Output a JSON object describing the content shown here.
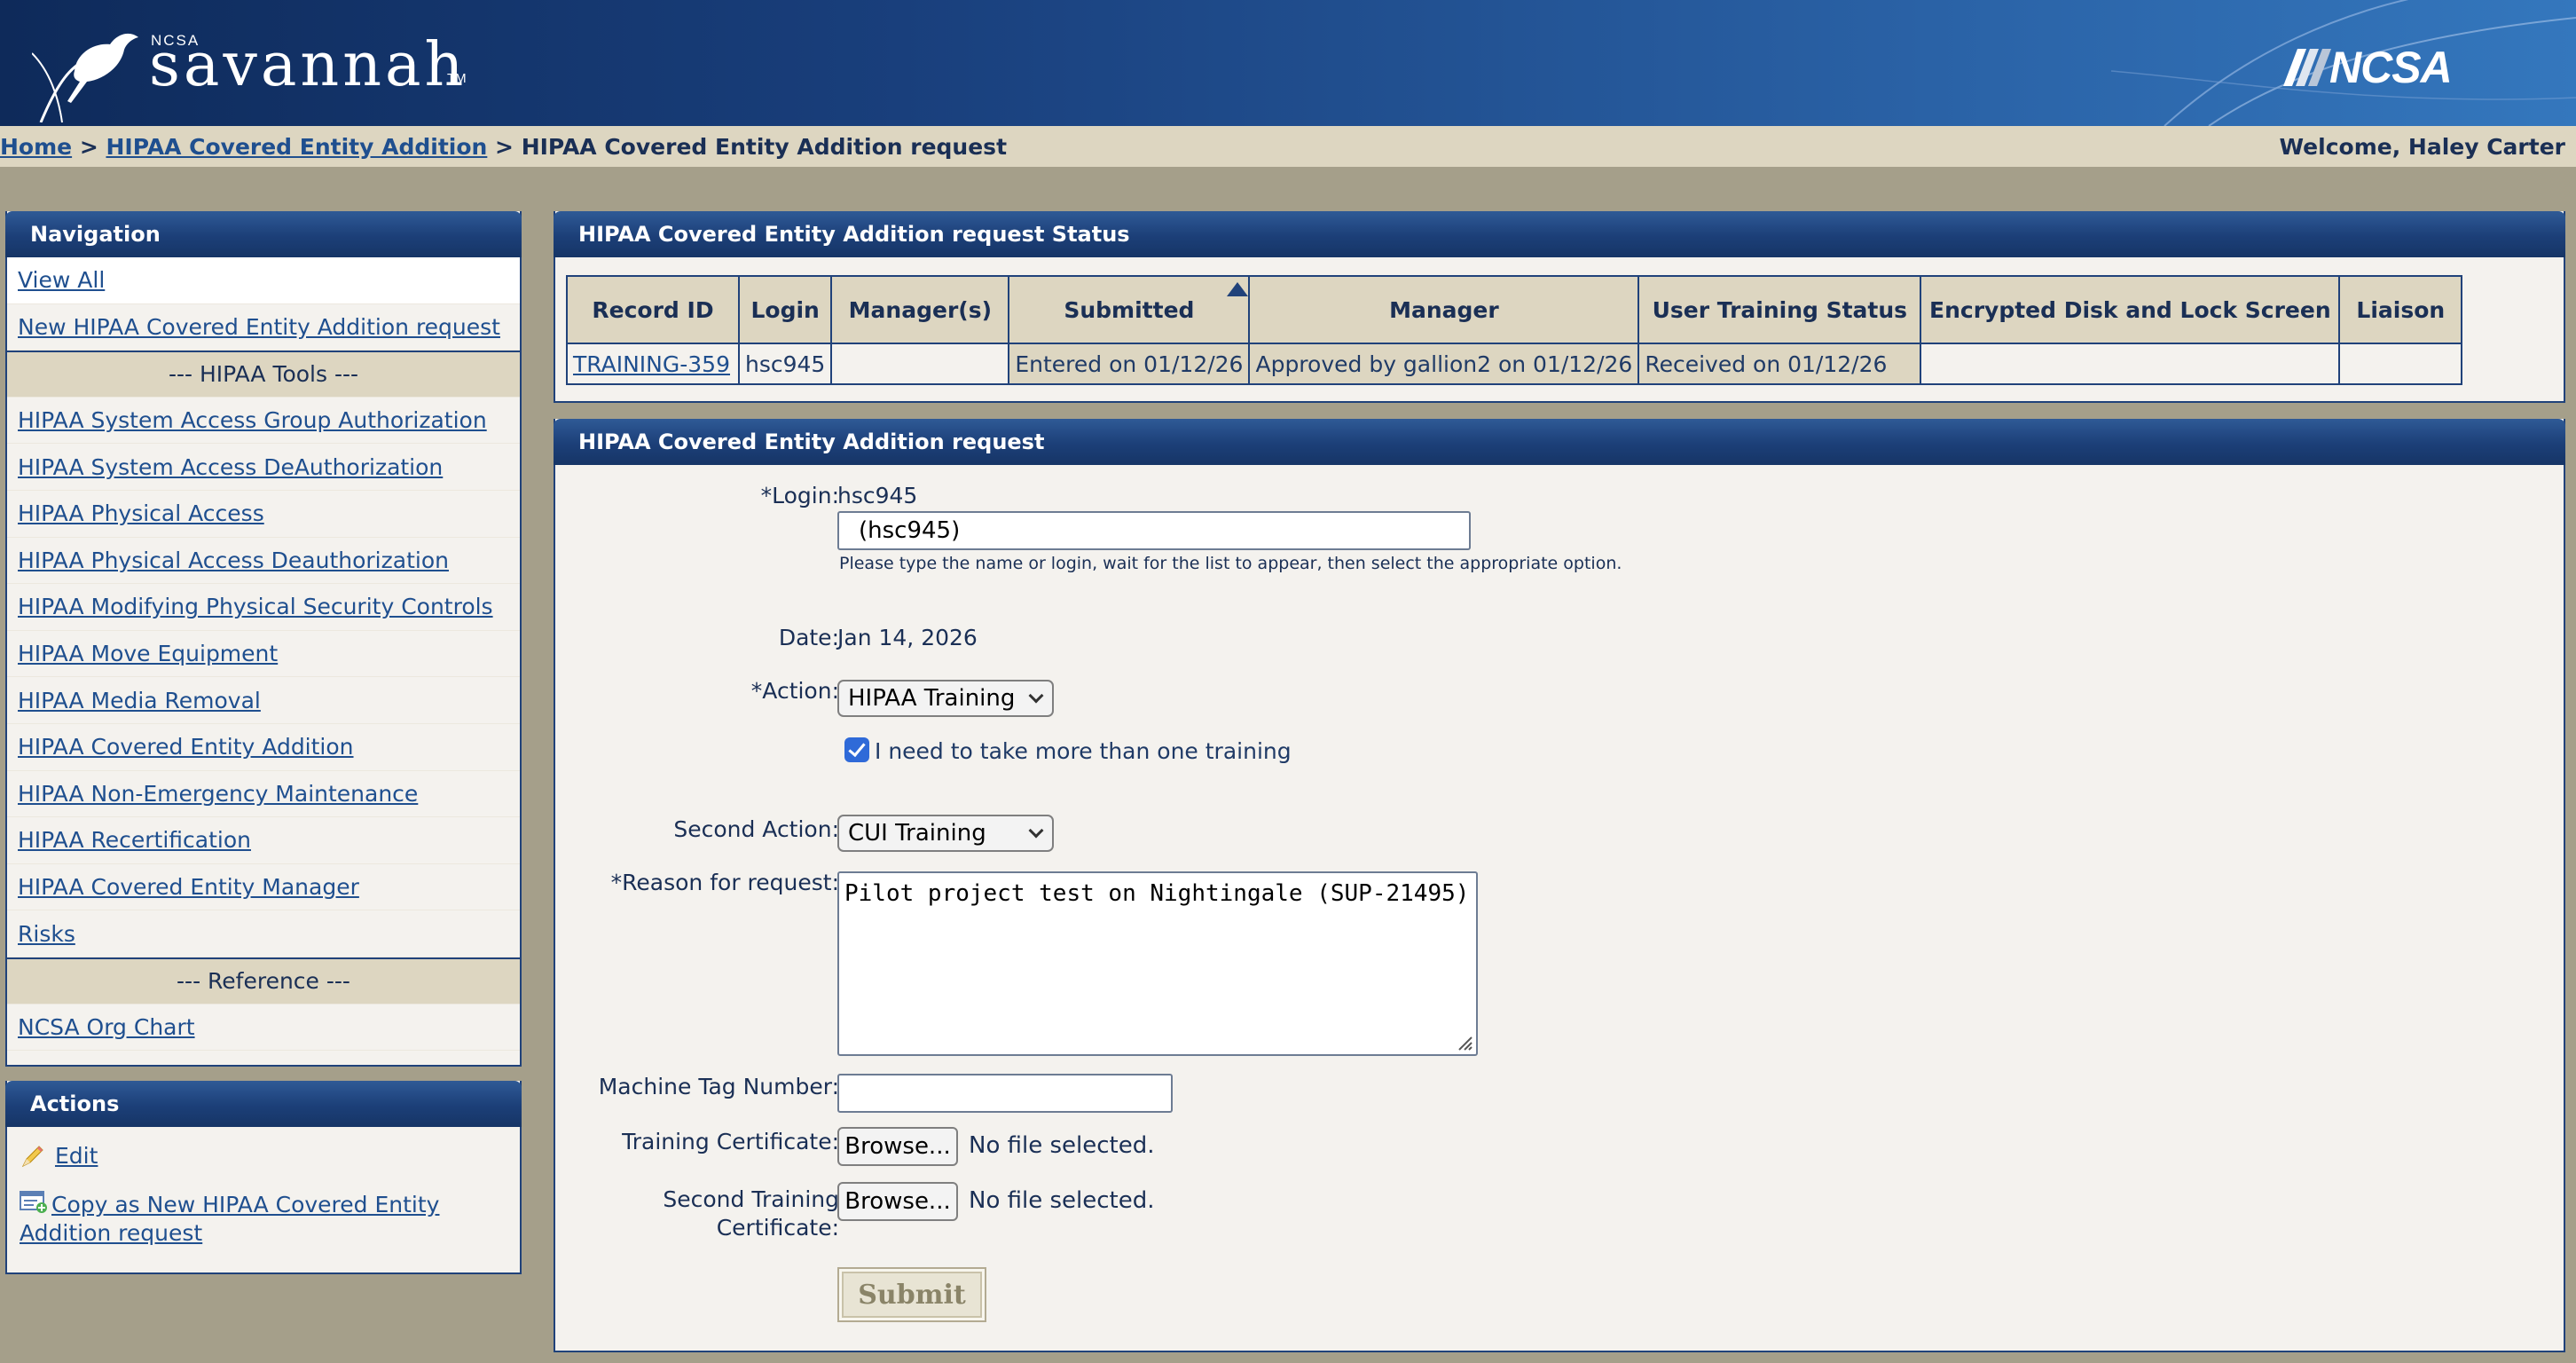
{
  "banner": {
    "org_small": "NCSA",
    "brand": "savannah",
    "tm": "TM",
    "logo_text": "NCSA"
  },
  "breadcrumb": {
    "home": "Home",
    "sep1": " > ",
    "section": "HIPAA Covered Entity Addition",
    "sep2": " > ",
    "current": "HIPAA Covered Entity Addition request",
    "welcome": "Welcome, Haley Carter"
  },
  "navigation": {
    "title": "Navigation",
    "items": [
      "View All",
      "New HIPAA Covered Entity Addition request"
    ],
    "tools_header": "--- HIPAA Tools ---",
    "tools": [
      "HIPAA System Access Group Authorization",
      "HIPAA System Access DeAuthorization",
      "HIPAA Physical Access",
      "HIPAA Physical Access Deauthorization",
      "HIPAA Modifying Physical Security Controls",
      "HIPAA Move Equipment",
      "HIPAA Media Removal",
      "HIPAA Covered Entity Addition",
      "HIPAA Non-Emergency Maintenance",
      "HIPAA Recertification",
      "HIPAA Covered Entity Manager",
      "Risks"
    ],
    "reference_header": "--- Reference ---",
    "reference": [
      "NCSA Org Chart"
    ]
  },
  "actions": {
    "title": "Actions",
    "edit": "Edit",
    "copy": "Copy as New HIPAA Covered Entity Addition request"
  },
  "status": {
    "title": "HIPAA Covered Entity Addition request Status",
    "columns": [
      "Record ID",
      "Login",
      "Manager(s)",
      "Submitted",
      "Manager",
      "User Training Status",
      "Encrypted Disk and Lock Screen",
      "Liaison"
    ],
    "row": {
      "record_id": "TRAINING-359",
      "login": "hsc945",
      "managers": "",
      "submitted": "Entered on 01/12/26",
      "manager": "Approved by gallion2 on 01/12/26",
      "training_status": "Received on 01/12/26",
      "encrypted": "",
      "liaison": ""
    }
  },
  "form": {
    "title": "HIPAA Covered Entity Addition request",
    "login_label": "*Login:",
    "login_value": "hsc945",
    "login_input": "(hsc945)",
    "login_hint": "Please type the name or login, wait for the list to appear, then select the appropriate option.",
    "date_label": "Date:",
    "date_value": "Jan 14, 2026",
    "action_label": "*Action:",
    "action_value": "HIPAA Training",
    "multi_training_label": "I need to take more than one training",
    "multi_training_checked": true,
    "second_action_label": "Second Action:",
    "second_action_value": "CUI Training",
    "reason_label": "*Reason for request:",
    "reason_value": "Pilot project test on Nightingale (SUP-21495)",
    "machine_tag_label": "Machine Tag Number:",
    "machine_tag_value": "",
    "cert_label": "Training Certificate:",
    "second_cert_label_line1": "Second Training",
    "second_cert_label_line2": "Certificate:",
    "browse_label": "Browse...",
    "no_file": "No file selected.",
    "submit_label": "Submit"
  },
  "colors": {
    "banner": "#1c3f78",
    "panel_header": "#1c3f78",
    "tan": "#ddd6c1",
    "background": "#a59f8a",
    "link": "#1f4f8f"
  }
}
